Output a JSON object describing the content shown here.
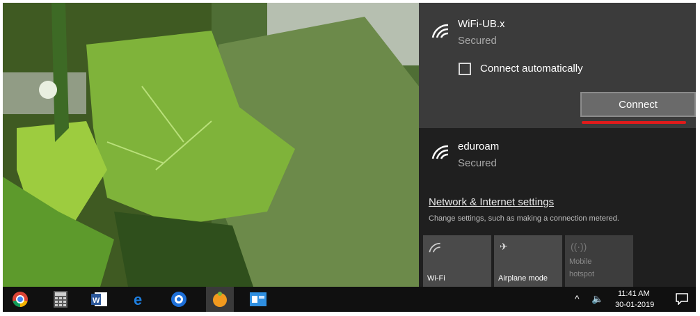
{
  "flyout": {
    "selected_network": {
      "name": "WiFi-UB.x",
      "status": "Secured"
    },
    "connect_automatically_label": "Connect automatically",
    "connect_automatically_checked": false,
    "connect_button_label": "Connect",
    "other_networks": [
      {
        "name": "eduroam",
        "status": "Secured"
      }
    ],
    "settings_link": "Network & Internet settings",
    "settings_description": "Change settings, such as making a connection metered.",
    "tiles": [
      {
        "label": "Wi-Fi",
        "icon": "wifi-icon"
      },
      {
        "label": "Airplane mode",
        "icon": "airplane-icon"
      },
      {
        "label": "Mobile\nhotspot",
        "label_line1": "Mobile",
        "label_line2": "hotspot",
        "icon": "hotspot-icon"
      }
    ]
  },
  "taskbar": {
    "apps": [
      "chrome-icon",
      "calculator-icon",
      "word-icon",
      "edge-icon",
      "app-blue-icon",
      "app-orange-icon",
      "app-window-icon"
    ],
    "clock_time": "11:41 AM",
    "clock_date": "30-01-2019"
  },
  "colors": {
    "flyout_bg": "#1f1f1f",
    "selected_bg": "#3b3b3b",
    "accent_red": "#e01b1b",
    "taskbar_bg": "#101010"
  }
}
